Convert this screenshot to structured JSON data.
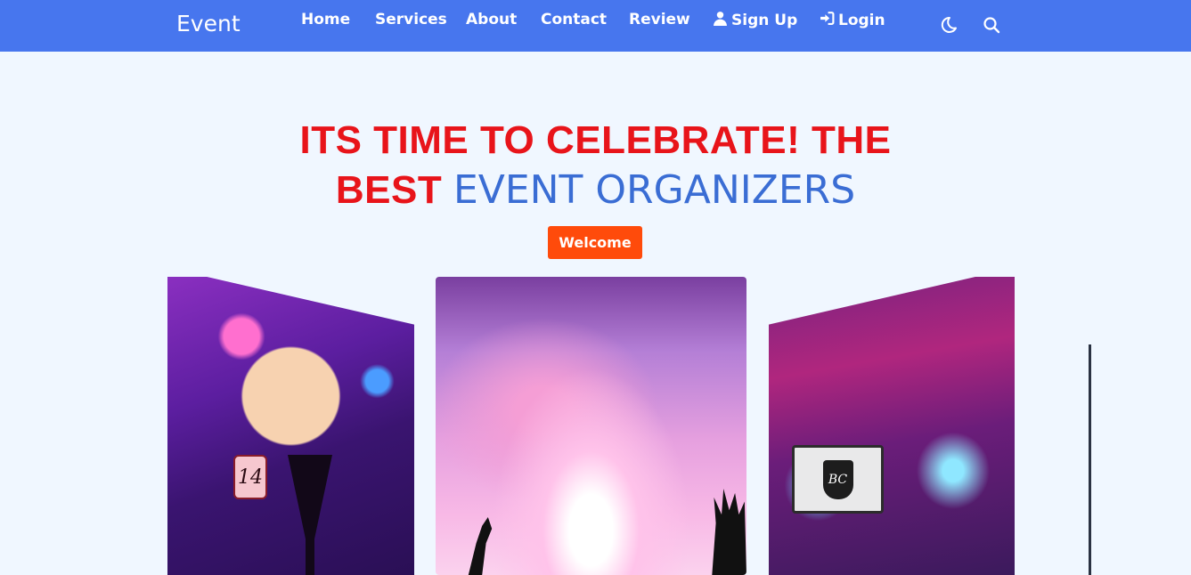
{
  "navbar": {
    "brand": "Event",
    "links": [
      {
        "label": "Home"
      },
      {
        "label": "Services"
      },
      {
        "label": "About"
      },
      {
        "label": "Contact"
      },
      {
        "label": "Review"
      },
      {
        "label": "Sign Up",
        "icon": "user-icon"
      },
      {
        "label": "Login",
        "icon": "sign-in-icon"
      }
    ],
    "icons": [
      "moon-icon",
      "search-icon"
    ],
    "background_color": "#4776ee"
  },
  "hero": {
    "title_red": "ITS TIME TO CELEBRATE! THE",
    "title_red_2": "BEST",
    "title_blue": "EVENT ORGANIZERS",
    "button_label": "Welcome",
    "red_color": "#e8141a",
    "blue_color": "#3a6dd4",
    "button_color": "#ff4b0b"
  },
  "carousel": {
    "cards": [
      {
        "name": "floral-table-image",
        "table_number": "14"
      },
      {
        "name": "concert-crowd-image"
      },
      {
        "name": "stage-hall-image",
        "logo_text": "BC"
      },
      {
        "name": "partial-image"
      }
    ]
  }
}
